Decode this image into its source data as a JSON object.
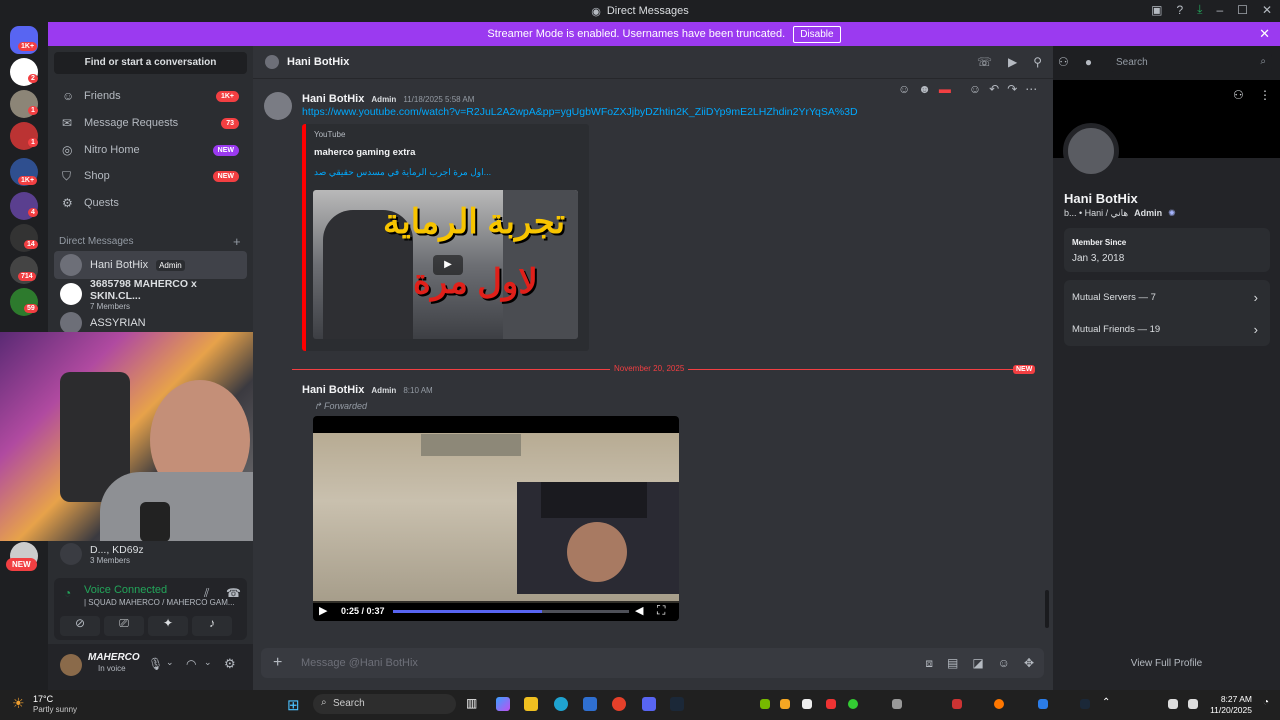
{
  "window": {
    "title": "Direct Messages"
  },
  "banner": {
    "text": "Streamer Mode is enabled. Usernames have been truncated.",
    "button": "Disable"
  },
  "servers": {
    "badges": [
      "1K+",
      "2",
      "1",
      "1",
      "1K+",
      "4",
      "14",
      "714",
      "59"
    ],
    "new_label": "NEW"
  },
  "sidebar": {
    "find": "Find or start a conversation",
    "nav": [
      {
        "label": "Friends",
        "badge": "1K+",
        "icon": "friends-icon"
      },
      {
        "label": "Message Requests",
        "badge": "73",
        "icon": "envelope-icon"
      },
      {
        "label": "Nitro Home",
        "badge": "NEW",
        "icon": "nitro-icon"
      },
      {
        "label": "Shop",
        "badge": "NEW",
        "icon": "shop-icon"
      },
      {
        "label": "Quests",
        "badge": "",
        "icon": "quests-icon"
      }
    ],
    "dm_header": "Direct Messages",
    "dms": [
      {
        "name": "Hani BotHix",
        "tag": "Admin",
        "sub": ""
      },
      {
        "name": "3685798 MAHERCO x SKIN.CL...",
        "tag": "",
        "sub": "7 Members"
      },
      {
        "name": "ASSYRIAN",
        "tag": "",
        "sub": ""
      },
      {
        "name": "D..., KD69z",
        "tag": "",
        "sub": "3 Members"
      }
    ],
    "voice": {
      "status": "Voice Connected",
      "channel": "| SQUAD MAHERCO / MAHERCO GAM..."
    },
    "user": {
      "name": "MAHERCO",
      "status": "In voice"
    }
  },
  "header": {
    "name": "Hani BotHix",
    "search_placeholder": "Search"
  },
  "messages": [
    {
      "author": "Hani BotHix",
      "tag": "Admin",
      "time": "11/18/2025 5:58 AM",
      "link": "https://www.youtube.com/watch?v=R2JuL2A2wpA&pp=ygUgbWFoZXJjbyDZhtin2K_ZiiDYp9mE2LHZhdin2YrYqSA%3D",
      "embed": {
        "provider": "YouTube",
        "title": "maherco gaming extra",
        "desc": "اول مرة اجرب الرماية في مسدس حقيقي صد...",
        "thumb_text_top": "تجربة الرماية",
        "thumb_text_bottom": "لاول مرة"
      }
    },
    {
      "author": "Hani BotHix",
      "tag": "Admin",
      "time": "8:10 AM",
      "forwarded": "Forwarded",
      "video_time": "0:25 / 0:37",
      "progress": 0.63
    }
  ],
  "divider": {
    "label": "November 20, 2025",
    "new": "NEW"
  },
  "composer": {
    "placeholder": "Message @Hani BotHix"
  },
  "profile": {
    "name": "Hani BotHix",
    "sub": "b... • Hani / هاني",
    "tag": "Admin",
    "member_since_label": "Member Since",
    "member_since": "Jan 3, 2018",
    "mutual_servers": "Mutual Servers — 7",
    "mutual_friends": "Mutual Friends — 19",
    "view_full": "View Full Profile"
  },
  "taskbar": {
    "weather_temp": "17°C",
    "weather_desc": "Partly sunny",
    "search": "Search",
    "time": "8:27 AM",
    "date": "11/20/2025"
  }
}
